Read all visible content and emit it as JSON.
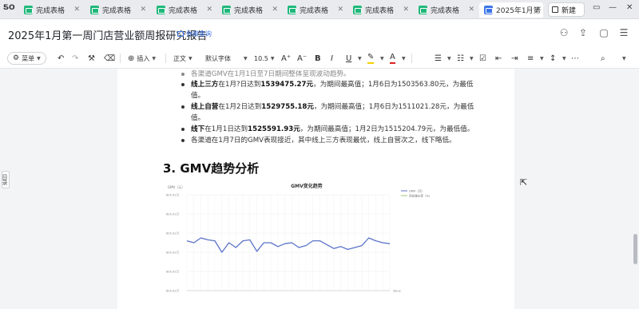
{
  "tabbar": {
    "logo": "ƼO",
    "tabs": [
      {
        "label": "完成表格"
      },
      {
        "label": "完成表格"
      },
      {
        "label": "完成表格"
      },
      {
        "label": "完成表格"
      },
      {
        "label": "完成表格"
      },
      {
        "label": "完成表格"
      },
      {
        "label": "完成表格"
      }
    ],
    "active_tab": {
      "label": "2025年1月第"
    },
    "new_label": "新建"
  },
  "header": {
    "title": "2025年1月第一周门店营业额周报研究报告",
    "share_label": "你被查询"
  },
  "toolbar": {
    "menu_label": "菜单",
    "insert_label": "插入",
    "style_label": "正文",
    "font_label": "默认字体",
    "size_label": "10.5",
    "bold": "B",
    "italic": "I",
    "underline": "U",
    "font_color": "A",
    "grow": "A⁺",
    "shrink": "A⁻"
  },
  "outline_tab": "目录",
  "content": {
    "bullets": [
      {
        "prefix": "各渠道GMV在1月1日至7日期间整体呈现波动趋势。",
        "gray": true
      },
      {
        "bold": "线上三方",
        "text1": "在1月?日达到",
        "value": "1539475.27元",
        "text2": "，为期间最高值；1月6日为1503563.80元，为最低值。"
      },
      {
        "bold": "线上自营",
        "text1": "在1月2日达到",
        "value": "1529755.18元",
        "text2": "，为期间最高值；1月6日为1511021.28元，为最低值。"
      },
      {
        "bold": "线下",
        "text1": "在1月1日达到",
        "value": "1525591.93元",
        "text2": "，为期间最高值；1月2日为1515204.79元，为最低值。"
      },
      {
        "prefix": "各渠道在1月7日的GMV表现接近，其中线上三方表现最优，线上自营次之，线下略低。",
        "gray": false
      }
    ],
    "heading": "3.  GMV趋势分析"
  },
  "chart_data": {
    "type": "line",
    "title": "GMV变化趋势",
    "ylabel": "GMV（元）",
    "xlabel": "Value",
    "legend": [
      "GMV（元）",
      "同比增长率（%）"
    ],
    "legend_position": "top-right",
    "grid": true,
    "series_color": "#5b73c8",
    "yticks": [
      "605.41万",
      "605.41万",
      "605.41万",
      "605.41万",
      "605.41万",
      "605.41万"
    ],
    "values": [
      0.52,
      0.5,
      0.55,
      0.53,
      0.52,
      0.4,
      0.5,
      0.45,
      0.52,
      0.53,
      0.41,
      0.5,
      0.5,
      0.46,
      0.49,
      0.5,
      0.45,
      0.47,
      0.52,
      0.52,
      0.48,
      0.44,
      0.46,
      0.43,
      0.45,
      0.47,
      0.55,
      0.52,
      0.5,
      0.49
    ]
  }
}
